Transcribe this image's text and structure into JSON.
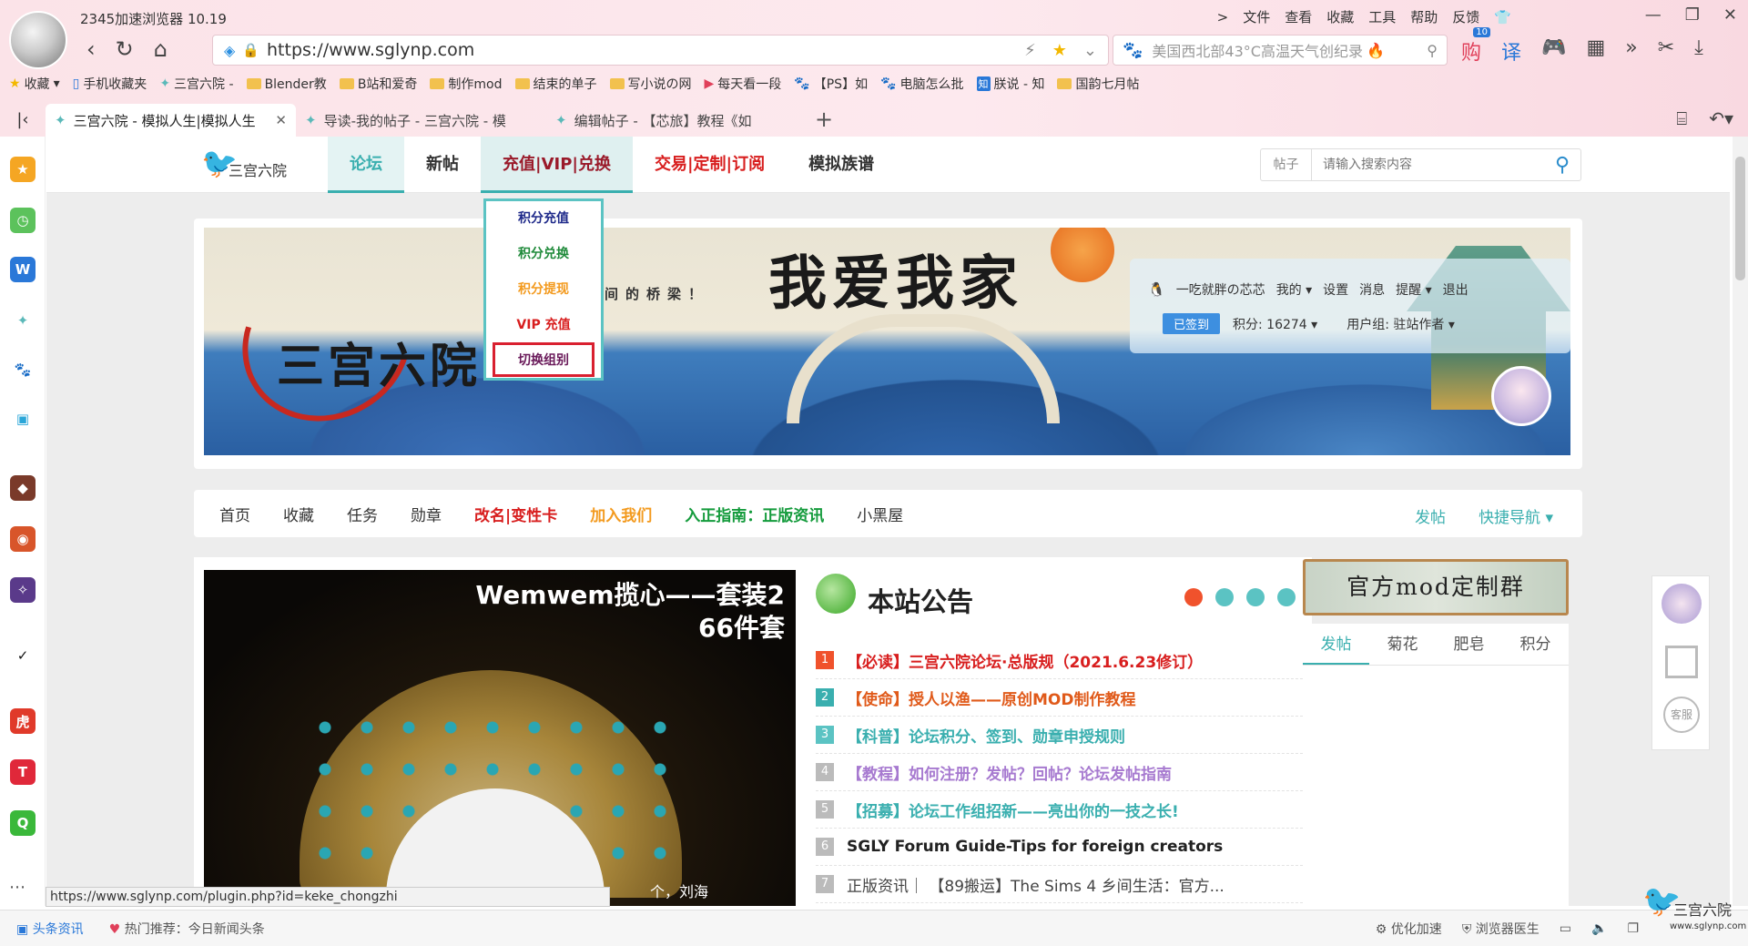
{
  "browser": {
    "title": "2345加速浏览器 10.19",
    "menu": [
      ">",
      "文件",
      "查看",
      "收藏",
      "工具",
      "帮助",
      "反馈"
    ],
    "url": "https://www.sglynp.com",
    "news_search": "美国西北部43°C高温天气创纪录",
    "ext_badge": "10"
  },
  "bookmarks": [
    {
      "label": "收藏",
      "icon": "star-icon"
    },
    {
      "label": "手机收藏夹",
      "icon": "phone-icon"
    },
    {
      "label": "三宫六院 -",
      "icon": "site-icon"
    },
    {
      "label": "Blender教",
      "icon": "folder-icon"
    },
    {
      "label": "B站和爱奇",
      "icon": "folder-icon"
    },
    {
      "label": "制作mod",
      "icon": "folder-icon"
    },
    {
      "label": "结束的单子",
      "icon": "folder-icon"
    },
    {
      "label": "写小说の网",
      "icon": "folder-icon"
    },
    {
      "label": "每天看一段",
      "icon": "video-icon"
    },
    {
      "label": "【PS】如",
      "icon": "paw-icon"
    },
    {
      "label": "电脑怎么批",
      "icon": "paw-icon"
    },
    {
      "label": "朕说 - 知",
      "icon": "zhihu-icon"
    },
    {
      "label": "国韵七月帖",
      "icon": "folder-icon"
    }
  ],
  "tabs": [
    {
      "label": "三宫六院 - 模拟人生|模拟人生",
      "active": true
    },
    {
      "label": "导读-我的帖子 - 三宫六院 - 模",
      "active": false
    },
    {
      "label": "编辑帖子 - 【芯旅】教程《如",
      "active": false
    }
  ],
  "site": {
    "logo_text": "三宫六院",
    "nav": [
      {
        "label": "论坛",
        "state": "active"
      },
      {
        "label": "新帖",
        "state": "normal"
      },
      {
        "label": "充值|VIP|兑换",
        "state": "open"
      },
      {
        "label": "交易|定制|订阅",
        "state": "red"
      },
      {
        "label": "模拟族谱",
        "state": "normal"
      }
    ],
    "search_category": "帖子",
    "search_placeholder": "请输入搜索内容",
    "dropdown": [
      {
        "label": "积分充值",
        "color": "#1f2a8a"
      },
      {
        "label": "积分兑换",
        "color": "#1f8a3a"
      },
      {
        "label": "积分提现",
        "color": "#f39a1e"
      },
      {
        "label": "VIP 充值",
        "color": "#d81e1e"
      },
      {
        "label": "切换组别",
        "color": "#6a1a5a"
      }
    ]
  },
  "banner": {
    "slogan": "我爱我家",
    "sub": "间的桥梁！",
    "name": "三宫六院"
  },
  "user": {
    "name": "一吃就胖の芯芯",
    "links": [
      "我的",
      "设置",
      "消息",
      "提醒",
      "退出"
    ],
    "checkin": "已签到",
    "points_label": "积分: 16274",
    "group_label": "用户组: 驻站作者"
  },
  "subnav": [
    {
      "label": "首页",
      "style": "normal"
    },
    {
      "label": "收藏",
      "style": "normal"
    },
    {
      "label": "任务",
      "style": "normal"
    },
    {
      "label": "勋章",
      "style": "normal"
    },
    {
      "label": "改名|变性卡",
      "style": "red"
    },
    {
      "label": "加入我们",
      "style": "orange"
    },
    {
      "label": "入正指南：正版资讯",
      "style": "green"
    },
    {
      "label": "小黑屋",
      "style": "normal"
    }
  ],
  "subnav_right": {
    "post": "发帖",
    "quick": "快捷导航"
  },
  "slide": {
    "title_line1": "Wemwem揽心——套装2",
    "title_line2": "66件套",
    "caption": "个，刘海"
  },
  "notice": {
    "title": "本站公告",
    "items": [
      {
        "num": "1",
        "text": "【必读】三宫六院论坛·总版规（2021.6.23修订）",
        "color": "#d81e1e",
        "num_bg": "#f0522c"
      },
      {
        "num": "2",
        "text": "【使命】授人以渔——原创MOD制作教程",
        "color": "#e05a1a",
        "num_bg": "#3aafaf"
      },
      {
        "num": "3",
        "text": "【科普】论坛积分、签到、勋章申授规则",
        "color": "#3aafaf",
        "num_bg": "#5bc3c3"
      },
      {
        "num": "4",
        "text": "【教程】如何注册？发帖？回帖？论坛发帖指南",
        "color": "#a77ad0",
        "num_bg": "#bbbbbb"
      },
      {
        "num": "5",
        "text": "【招募】论坛工作组招新——亮出你的一技之长!",
        "color": "#3aafaf",
        "num_bg": "#bbbbbb"
      },
      {
        "num": "6",
        "text": "SGLY Forum Guide-Tips for foreign creators",
        "color": "#222222",
        "num_bg": "#bbbbbb"
      },
      {
        "num": "7",
        "text": "正版资讯｜ 【89搬运】The Sims 4 乡间生活：官方...",
        "color": "#444444",
        "num_bg": "#bbbbbb"
      }
    ]
  },
  "right": {
    "banner": "官方mod定制群",
    "tabs": [
      "发帖",
      "菊花",
      "肥皂",
      "积分"
    ]
  },
  "float": {
    "service": "客服"
  },
  "status": {
    "url": "https://www.sglynp.com/plugin.php?id=keke_chongzhi",
    "left": [
      "头条资讯",
      "热门推荐：今日新闻头条"
    ],
    "right": [
      "优化加速",
      "浏览器医生"
    ]
  },
  "corner": {
    "name": "三宫六院",
    "url": "www.sglynp.com"
  }
}
